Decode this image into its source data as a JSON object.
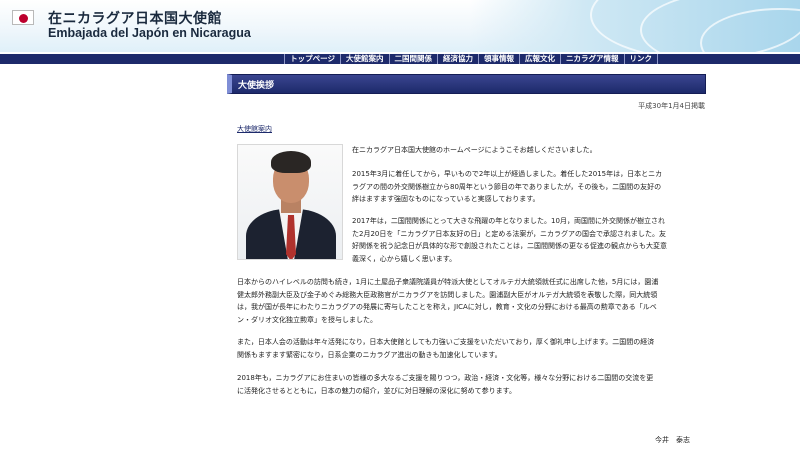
{
  "header": {
    "title_jp": "在ニカラグア日本国大使館",
    "title_es": "Embajada del Japón en Nicaragua"
  },
  "nav": {
    "items": [
      {
        "label": "トップページ"
      },
      {
        "label": "大使館案内"
      },
      {
        "label": "二国間関係"
      },
      {
        "label": "経済協力"
      },
      {
        "label": "領事情報"
      },
      {
        "label": "広報文化"
      },
      {
        "label": "ニカラグア情報"
      },
      {
        "label": "リンク"
      }
    ]
  },
  "section": {
    "title": "大使挨拶"
  },
  "date": "平成30年1月4日掲載",
  "sublink": "大使館案内",
  "paragraphs": {
    "p1": [
      "在ニカラグア日本国大使館のホームページにようこそお越しくださいました。"
    ],
    "p2": [
      "2015年3月に着任してから，早いもので2年以上が経過しました。着任した2015年は，日本とニカ",
      "ラグアの間の外交関係樹立から80周年という節目の年でありましたが，その後も，二国間の友好の",
      "絆はますます強固なものになっていると実感しております。"
    ],
    "p3": [
      "2017年は，二国間関係にとって大きな飛躍の年となりました。10月，両国間に外交関係が樹立され",
      "た2月20日を「ニカラグア日本友好の日」と定める法案が，ニカラグアの国会で承認されました。友",
      "好関係を祝う記念日が具体的な形で創設されたことは，二国間関係の更なる促進の観点からも大変意",
      "義深く，心から嬉しく思います。"
    ],
    "p4": [
      "日本からのハイレベルの訪問も続き，1月に土屋品子衆議院議員が特派大使としてオルテガ大統領就任式に出席した他，5月には，園浦",
      "健太郎外務副大臣及び金子めぐみ総務大臣政務官がニカラグアを訪問しました。園浦副大臣がオルテガ大統領を表敬した際，同大統領",
      "は，我が国が長年にわたりニカラグアの発展に寄与したことを称え，JICAに対し，教育・文化の分野における最高の勲章である「ルベ",
      "ン・ダリオ文化独立勲章」を授与しました。"
    ],
    "p5": [
      "また，日本人会の活動は年々活発になり，日本大使館としても力強いご支援をいただいており，厚く御礼申し上げます。二国間の経済",
      "関係もますます緊密になり，日系企業のニカラグア進出の動きも加速化しています。"
    ],
    "p6": [
      "2018年も，ニカラグアにお住まいの皆様の多大なるご支援を賜りつつ，政治・経済・文化等，様々な分野における二国間の交流を更",
      "に活発化させるとともに，日本の魅力の紹介，並びに対日理解の深化に努めて参ります。"
    ]
  },
  "signature": "今井　泰志",
  "colors": {
    "nav_bg": "#1d2a6b",
    "section_bar": "#1d2a6b",
    "flag_red": "#bc002d"
  }
}
